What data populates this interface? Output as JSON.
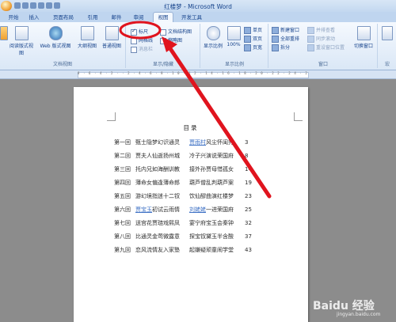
{
  "window": {
    "title": "红楼梦 - Microsoft Word"
  },
  "tabs": [
    "开始",
    "插入",
    "页面布局",
    "引用",
    "邮件",
    "审阅",
    "视图",
    "开发工具"
  ],
  "active_tab": "视图",
  "ribbon": {
    "doc_views": {
      "label": "文档视图",
      "buttons": [
        "页面视图",
        "阅读版式视图",
        "Web 版式视图",
        "大纲视图",
        "普通视图"
      ]
    },
    "show_hide": {
      "label": "显示/隐藏",
      "ruler": "标尺",
      "gridlines": "网格线",
      "message_bar": "消息栏",
      "doc_map": "文档结构图",
      "thumbnails": "缩略图"
    },
    "zoom": {
      "label": "显示比例",
      "zoom": "显示比例",
      "percent": "100%",
      "one_page": "单页",
      "two_pages": "双页",
      "page_width": "页宽"
    },
    "window": {
      "label": "窗口",
      "new_window": "新建窗口",
      "arrange_all": "全部重排",
      "split": "拆分",
      "side_by_side": "并排查看",
      "sync_scroll": "同步滚动",
      "reset_pos": "重设窗口位置",
      "switch": "切换窗口"
    },
    "macros": {
      "label": "宏"
    }
  },
  "document": {
    "heading": "目录",
    "toc": [
      {
        "ch": "第一回",
        "t1": "甄士隐梦幻识通灵",
        "t2": "贾雨村风尘怀闺秀",
        "pg": "3",
        "link": "贾雨村"
      },
      {
        "ch": "第二回",
        "t1": "贾夫人仙逝扬州城",
        "t2": "冷子兴演说荣国府",
        "pg": "8"
      },
      {
        "ch": "第三回",
        "t1": "托内兄如海酬训教",
        "t2": "接外孙贾母惜孤女",
        "pg": "14"
      },
      {
        "ch": "第四回",
        "t1": "薄命女偏逢薄命郎",
        "t2": "葫芦僧乱判葫芦案",
        "pg": "19"
      },
      {
        "ch": "第五回",
        "t1": "游幻境指迷十二钗",
        "t2": "饮仙醪曲演红楼梦",
        "pg": "23"
      },
      {
        "ch": "第六回",
        "t1": "贾宝玉初试云雨情",
        "t2": "刘姥姥一进荣国府",
        "pg": "25",
        "link1": "贾宝玉",
        "link2": "刘姥姥"
      },
      {
        "ch": "第七回",
        "t1": "送宫花贾琏戏熙凤",
        "t2": "宴宁府宝玉会秦钟",
        "pg": "32"
      },
      {
        "ch": "第八回",
        "t1": "比通灵金莺微露意",
        "t2": "探宝钗黛玉半含酸",
        "pg": "37"
      },
      {
        "ch": "第九回",
        "t1": "恋风流情友入家塾",
        "t2": "起嫌疑顽童闹学堂",
        "pg": "43"
      }
    ]
  },
  "watermark": {
    "text": "Baidu 经验",
    "url": "jingyan.baidu.com"
  },
  "colors": {
    "annotation": "#e0141e",
    "accent": "#15428b"
  }
}
